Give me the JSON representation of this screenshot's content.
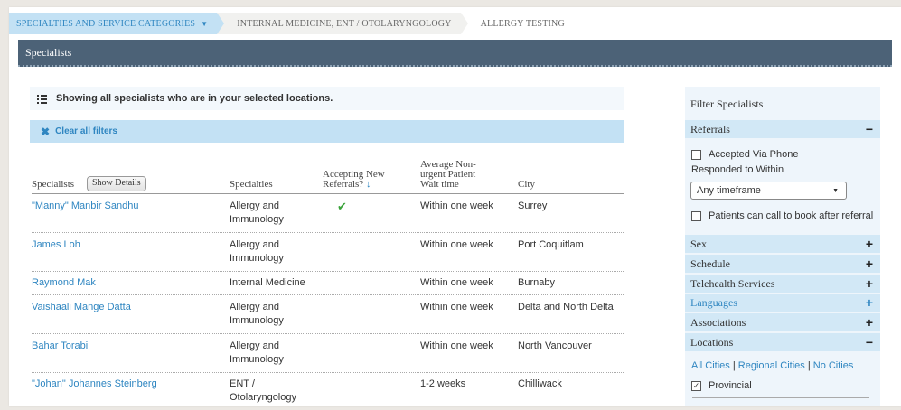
{
  "breadcrumb": {
    "items": [
      "SPECIALTIES AND SERVICE CATEGORIES",
      "INTERNAL MEDICINE, ENT / OTOLARYNGOLOGY",
      "ALLERGY TESTING"
    ],
    "caret": "▼"
  },
  "titlebar": {
    "title": "Specialists"
  },
  "notice": {
    "text": "Showing all specialists who are in your selected locations."
  },
  "clear_filters": {
    "label": "Clear all filters",
    "icon": "✖"
  },
  "table": {
    "headers": {
      "specialists": "Specialists",
      "show_details": "Show Details",
      "specialties": "Specialties",
      "accepting_line1": "Accepting New",
      "accepting_line2": "Referrals?",
      "sort_icon": "↓",
      "wait_line1": "Average Non-",
      "wait_line2": "urgent Patient",
      "wait_line3": "Wait time",
      "city": "City"
    },
    "rows": [
      {
        "name": "\"Manny\" Manbir Sandhu",
        "specialty": "Allergy and Immunology",
        "accepting": "✔",
        "wait": "Within one week",
        "city": "Surrey"
      },
      {
        "name": "James Loh",
        "specialty": "Allergy and Immunology",
        "accepting": "",
        "wait": "Within one week",
        "city": "Port Coquitlam"
      },
      {
        "name": "Raymond Mak",
        "specialty": "Internal Medicine",
        "accepting": "",
        "wait": "Within one week",
        "city": "Burnaby"
      },
      {
        "name": "Vaishaali Mange Datta",
        "specialty": "Allergy and Immunology",
        "accepting": "",
        "wait": "Within one week",
        "city": "Delta and North Delta"
      },
      {
        "name": "Bahar Torabi",
        "specialty": "Allergy and Immunology",
        "accepting": "",
        "wait": "Within one week",
        "city": "North Vancouver"
      },
      {
        "name": "\"Johan\" Johannes Steinberg",
        "specialty": "ENT / Otolaryngology",
        "accepting": "",
        "wait": "1-2 weeks",
        "city": "Chilliwack"
      }
    ]
  },
  "sidebar": {
    "title": "Filter Specialists",
    "referrals": {
      "label": "Referrals",
      "toggle": "−"
    },
    "accepted_via_phone": "Accepted Via Phone",
    "responded_within": "Responded to Within",
    "timeframe_value": "Any timeframe",
    "timeframe_caret": "▼",
    "patients_can_call": "Patients can call to book after referral",
    "sections": [
      {
        "label": "Sex",
        "toggle": "+"
      },
      {
        "label": "Schedule",
        "toggle": "+"
      },
      {
        "label": "Telehealth Services",
        "toggle": "+"
      },
      {
        "label": "Languages",
        "toggle": "+"
      },
      {
        "label": "Associations",
        "toggle": "+"
      }
    ],
    "locations": {
      "label": "Locations",
      "toggle": "−"
    },
    "city_links": [
      "All Cities",
      "Regional Cities",
      "No Cities"
    ],
    "city_sep": "|",
    "provincial": "Provincial",
    "provincial_check": "✓"
  }
}
